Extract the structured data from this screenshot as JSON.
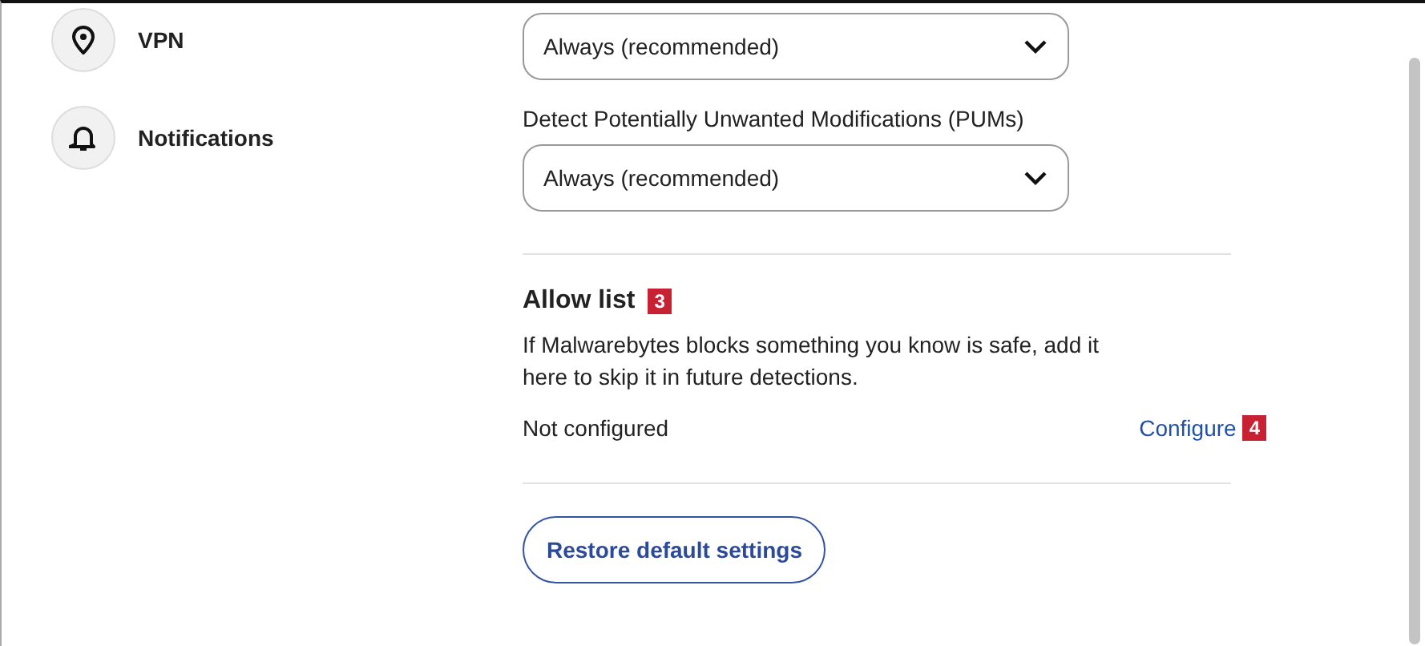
{
  "sidebar": {
    "items": [
      {
        "label": "VPN"
      },
      {
        "label": "Notifications"
      }
    ]
  },
  "settings": {
    "first_select": {
      "value": "Always (recommended)"
    },
    "pum": {
      "label": "Detect Potentially Unwanted Modifications (PUMs)",
      "value": "Always (recommended)"
    },
    "allow_list": {
      "title": "Allow list",
      "title_badge": "3",
      "description": "If Malwarebytes blocks something you know is safe, add it here to skip it in future detections.",
      "status": "Not configured",
      "link": "Configure",
      "link_badge": "4"
    },
    "restore_button": "Restore default settings"
  }
}
